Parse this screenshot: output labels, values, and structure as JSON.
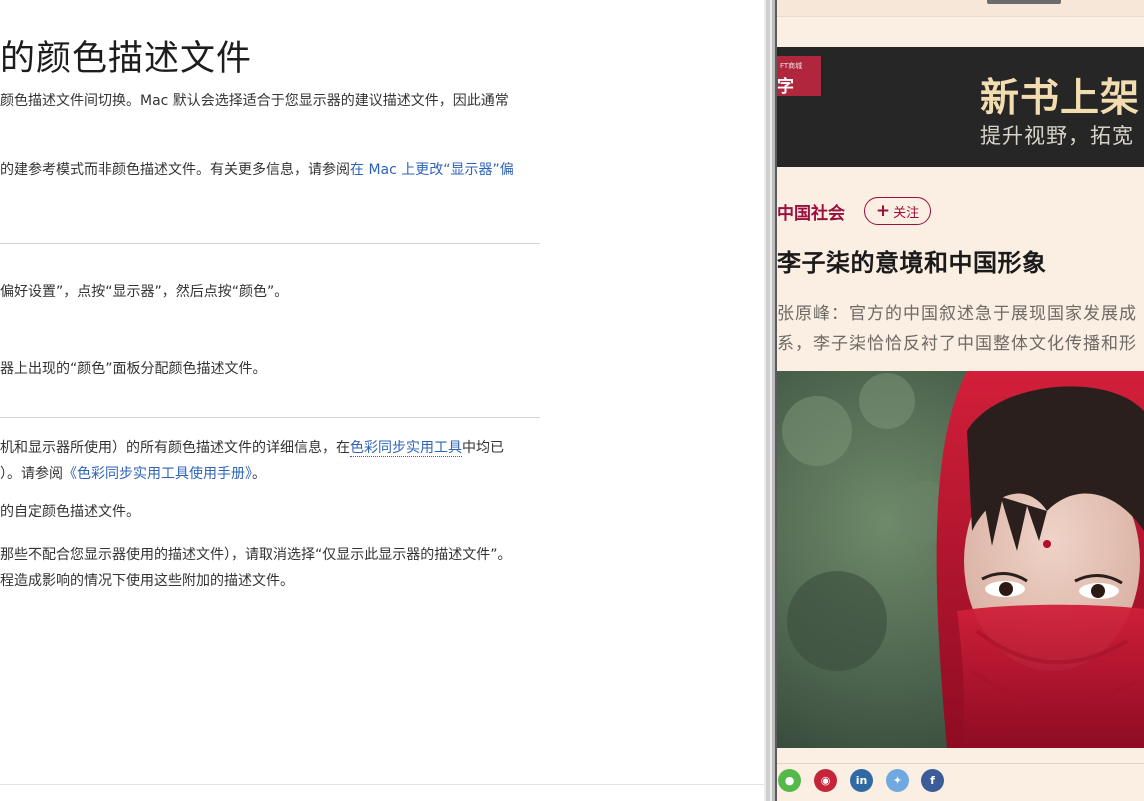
{
  "article": {
    "title": "的颜色描述文件",
    "intro_1": "颜色描述文件间切换。Mac 默认会选择适合于您显示器的建议描述文件，因此通常",
    "intro_2": "的建参考模式而非颜色描述文件。有关更多信息，请参阅",
    "intro_2_link": "在 Mac 上更改“显示器”偏",
    "step_1": "偏好设置”，点按“显示器”，然后点按“颜色”。",
    "step_2": "器上出现的“颜色”面板分配颜色描述文件。",
    "details_1_pre": "机和显示器所使用）的所有颜色描述文件的详细信息，在",
    "details_1_link": "色彩同步实用工具",
    "details_1_post": "中均已",
    "details_2_pre": "）。请参阅",
    "details_2_link": "《色彩同步实用工具使用手册》",
    "details_2_post": "。",
    "details_3": "的自定颜色描述文件。",
    "details_4": "那些不配合您显示器使用的描述文件），请取消选择“仅显示此显示器的描述文件”。",
    "details_5": "程造成影响的情况下使用这些附加的描述文件。"
  },
  "ft": {
    "banner_logo_small": "FT商城",
    "banner_logo_big": "字",
    "banner_title": "新书上架",
    "banner_subtitle": "提升视野，拓宽",
    "category": "中国社会",
    "follow_label": "关注",
    "follow_plus": "+",
    "headline": "李子柒的意境和中国形象",
    "lead_1": "张原峰：官方的中国叙述急于展现国家发展成",
    "lead_2": "系，李子柒恰恰反衬了中国整体文化传播和形",
    "share": [
      {
        "icon": "wechat-icon",
        "glyph": "●",
        "color": "#55b94a"
      },
      {
        "icon": "weibo-icon",
        "glyph": "◉",
        "color": "#c5253a"
      },
      {
        "icon": "linkedin-icon",
        "glyph": "in",
        "color": "#2f6aa4"
      },
      {
        "icon": "twitter-icon",
        "glyph": "✦",
        "color": "#6fa9e0"
      },
      {
        "icon": "facebook-icon",
        "glyph": "f",
        "color": "#3b5b99"
      }
    ]
  }
}
